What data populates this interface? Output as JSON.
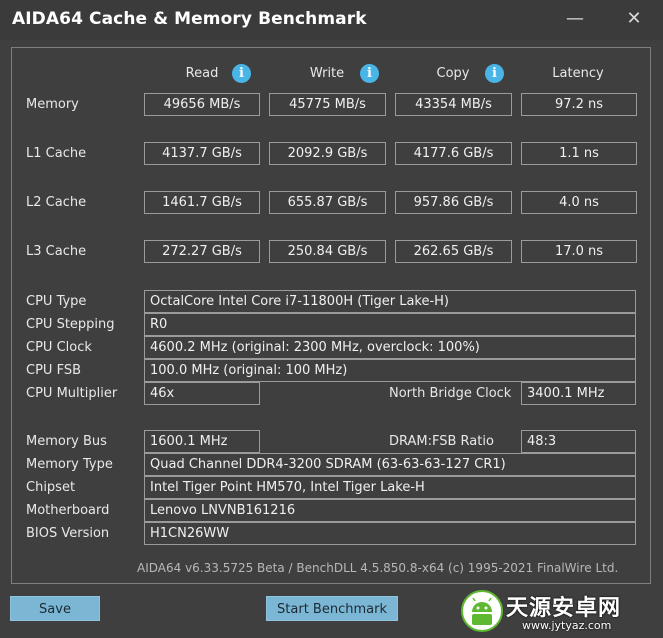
{
  "window": {
    "title": "AIDA64 Cache & Memory Benchmark",
    "minimize_glyph": "—",
    "close_glyph": "✕"
  },
  "headers": {
    "read": "Read",
    "write": "Write",
    "copy": "Copy",
    "latency": "Latency",
    "info_glyph": "i"
  },
  "rows": {
    "memory": {
      "label": "Memory",
      "read": "49656 MB/s",
      "write": "45775 MB/s",
      "copy": "43354 MB/s",
      "latency": "97.2 ns"
    },
    "l1": {
      "label": "L1 Cache",
      "read": "4137.7 GB/s",
      "write": "2092.9 GB/s",
      "copy": "4177.6 GB/s",
      "latency": "1.1 ns"
    },
    "l2": {
      "label": "L2 Cache",
      "read": "1461.7 GB/s",
      "write": "655.87 GB/s",
      "copy": "957.86 GB/s",
      "latency": "4.0 ns"
    },
    "l3": {
      "label": "L3 Cache",
      "read": "272.27 GB/s",
      "write": "250.84 GB/s",
      "copy": "262.65 GB/s",
      "latency": "17.0 ns"
    }
  },
  "cpu": {
    "type_label": "CPU Type",
    "type_value": "OctalCore Intel Core i7-11800H  (Tiger Lake-H)",
    "stepping_label": "CPU Stepping",
    "stepping_value": "R0",
    "clock_label": "CPU Clock",
    "clock_value": "4600.2 MHz  (original: 2300 MHz, overclock: 100%)",
    "fsb_label": "CPU FSB",
    "fsb_value": "100.0 MHz  (original: 100 MHz)",
    "multiplier_label": "CPU Multiplier",
    "multiplier_value": "46x",
    "nb_clock_label": "North Bridge Clock",
    "nb_clock_value": "3400.1 MHz"
  },
  "memory_info": {
    "bus_label": "Memory Bus",
    "bus_value": "1600.1 MHz",
    "ratio_label": "DRAM:FSB Ratio",
    "ratio_value": "48:3",
    "type_label": "Memory Type",
    "type_value": "Quad Channel DDR4-3200 SDRAM  (63-63-63-127 CR1)",
    "chipset_label": "Chipset",
    "chipset_value": "Intel Tiger Point HM570, Intel Tiger Lake-H",
    "motherboard_label": "Motherboard",
    "motherboard_value": "Lenovo LNVNB161216",
    "bios_label": "BIOS Version",
    "bios_value": "H1CN26WW"
  },
  "footer": "AIDA64 v6.33.5725 Beta / BenchDLL 4.5.850.8-x64  (c) 1995-2021 FinalWire Ltd.",
  "buttons": {
    "save": "Save",
    "start": "Start Benchmark"
  },
  "watermark": {
    "name": "天源安卓网",
    "url": "www.jytyaz.com"
  },
  "colors": {
    "background": "#3f3f3f",
    "info_icon": "#49b4e6",
    "button": "#7bb6d4",
    "watermark_green": "#5fb832"
  }
}
